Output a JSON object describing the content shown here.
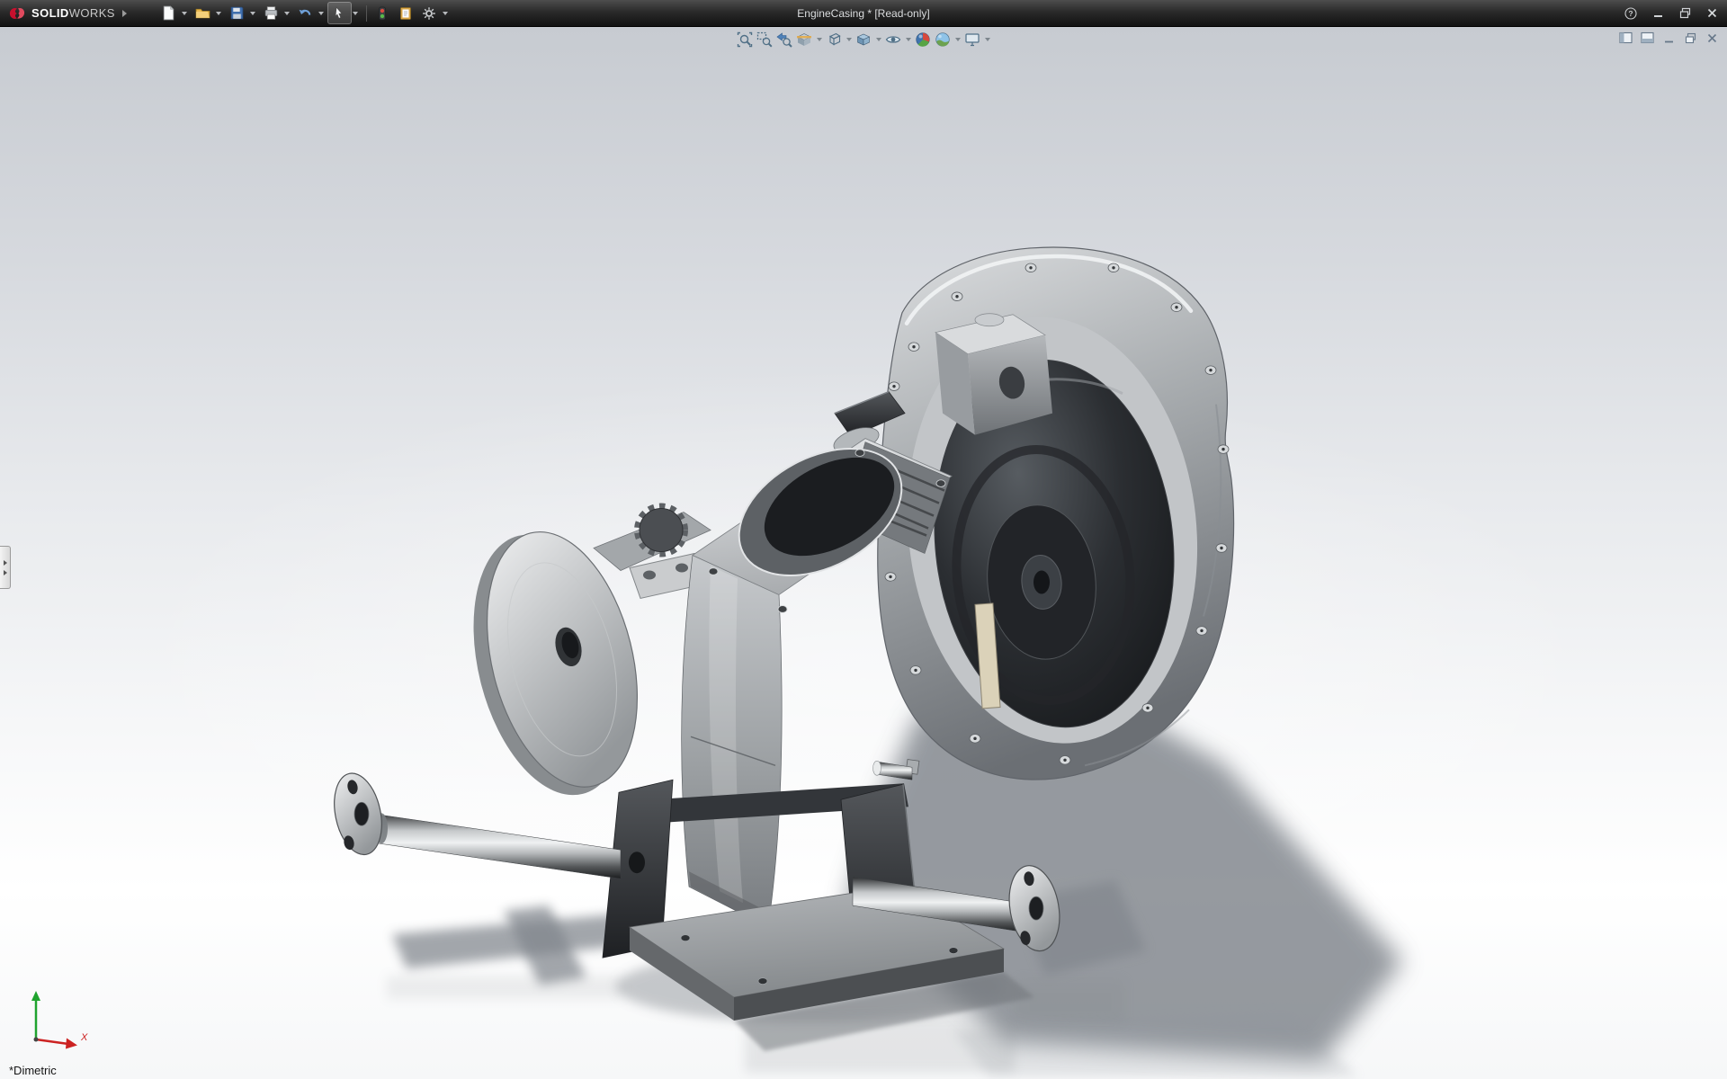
{
  "window": {
    "title": "EngineCasing * [Read-only]",
    "brand": {
      "bold": "SOLID",
      "light": "WORKS"
    },
    "controls": {
      "help": "Help",
      "minimize": "Minimize",
      "maximize": "Maximize",
      "close": "Close"
    }
  },
  "main_toolbar": {
    "items": [
      {
        "name": "new-document",
        "label": "New",
        "has_dropdown": true
      },
      {
        "name": "open",
        "label": "Open",
        "has_dropdown": true
      },
      {
        "name": "save",
        "label": "Save",
        "has_dropdown": true
      },
      {
        "name": "print",
        "label": "Print",
        "has_dropdown": true
      },
      {
        "name": "undo",
        "label": "Undo",
        "has_dropdown": true
      },
      {
        "name": "select",
        "label": "Select",
        "has_dropdown": true,
        "active": true
      },
      {
        "name": "rebuild",
        "label": "Rebuild",
        "has_dropdown": false
      },
      {
        "name": "file-properties",
        "label": "File Properties",
        "has_dropdown": false
      },
      {
        "name": "options",
        "label": "Options",
        "has_dropdown": true
      }
    ]
  },
  "heads_up_toolbar": {
    "items": [
      {
        "name": "zoom-to-fit",
        "label": "Zoom to Fit",
        "has_dropdown": false
      },
      {
        "name": "zoom-to-area",
        "label": "Zoom to Area",
        "has_dropdown": false
      },
      {
        "name": "previous-view",
        "label": "Previous View",
        "has_dropdown": false
      },
      {
        "name": "section-view",
        "label": "Section View",
        "has_dropdown": true
      },
      {
        "name": "view-orientation",
        "label": "View Orientation",
        "has_dropdown": true
      },
      {
        "name": "display-style",
        "label": "Display Style",
        "has_dropdown": true
      },
      {
        "name": "hide-show-items",
        "label": "Hide/Show Items",
        "has_dropdown": true
      },
      {
        "name": "edit-appearance",
        "label": "Edit Appearance",
        "has_dropdown": false
      },
      {
        "name": "apply-scene",
        "label": "Apply Scene",
        "has_dropdown": true
      },
      {
        "name": "view-settings",
        "label": "View Settings",
        "has_dropdown": true
      }
    ]
  },
  "document_controls": {
    "items": [
      {
        "name": "show-pane-left",
        "label": "Show Pane"
      },
      {
        "name": "show-pane-split",
        "label": "Split Pane"
      },
      {
        "name": "minimize-document",
        "label": "Minimize"
      },
      {
        "name": "restore-document",
        "label": "Restore"
      },
      {
        "name": "close-document",
        "label": "Close"
      }
    ]
  },
  "viewport": {
    "orientation_label": "*Dimetric",
    "triad": {
      "x_label": "X",
      "x_color": "#cc2222",
      "y_color": "#22992e"
    },
    "background": {
      "top": "#c7cbd1",
      "bottom": "#ffffff"
    }
  }
}
